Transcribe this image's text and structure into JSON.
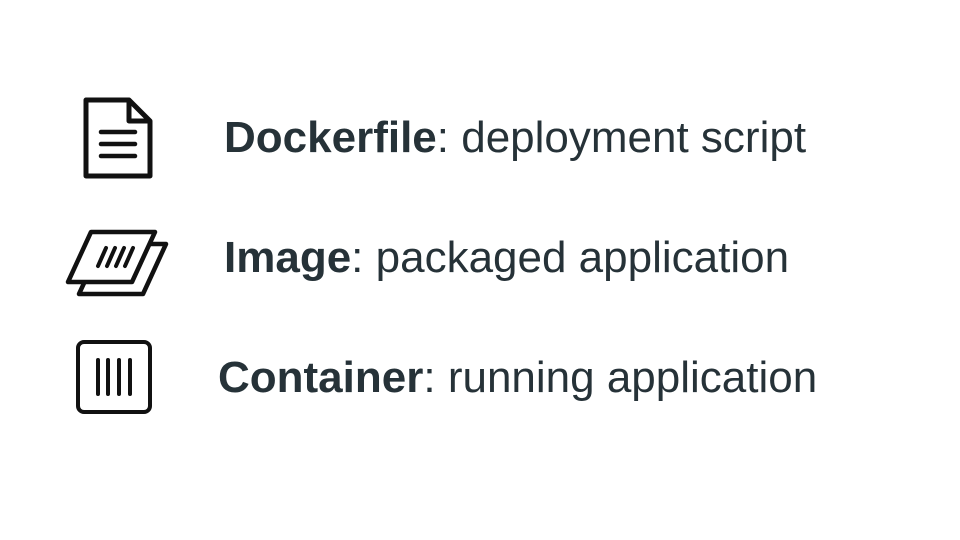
{
  "rows": [
    {
      "icon": "document-icon",
      "term": "Dockerfile",
      "separator": ":",
      "description": " deployment script"
    },
    {
      "icon": "stacked-layers-icon",
      "term": "Image",
      "separator": ":",
      "description": " packaged application"
    },
    {
      "icon": "container-box-icon",
      "term": "Container",
      "separator": ":",
      "description": " running application"
    }
  ],
  "colors": {
    "text": "#263238",
    "icon_stroke": "#111111",
    "background": "#ffffff"
  }
}
